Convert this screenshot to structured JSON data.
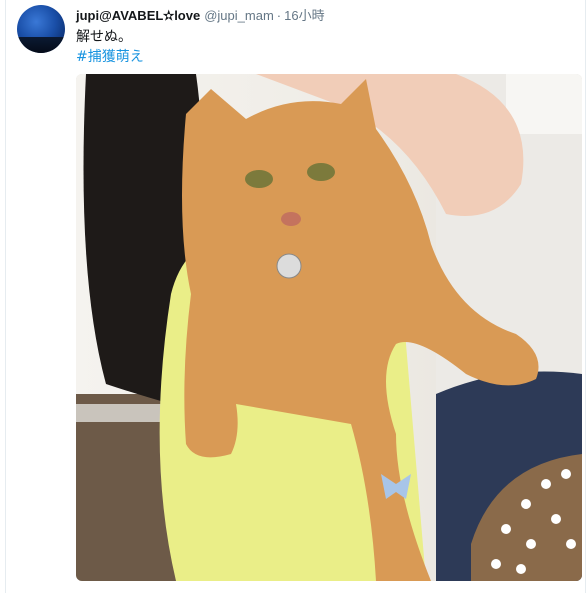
{
  "tweet": {
    "display_name": "jupi@AVABEL✫love",
    "handle": "@jupi_mam",
    "separator": "·",
    "time": "16小時",
    "text": "解せぬ。",
    "hashtag": "#捕獲萌え"
  },
  "media": {
    "description_icon": "photo-cat-held-up"
  },
  "colors": {
    "link": "#1b95e0",
    "secondary": "#657786",
    "primary_text": "#14171a"
  }
}
